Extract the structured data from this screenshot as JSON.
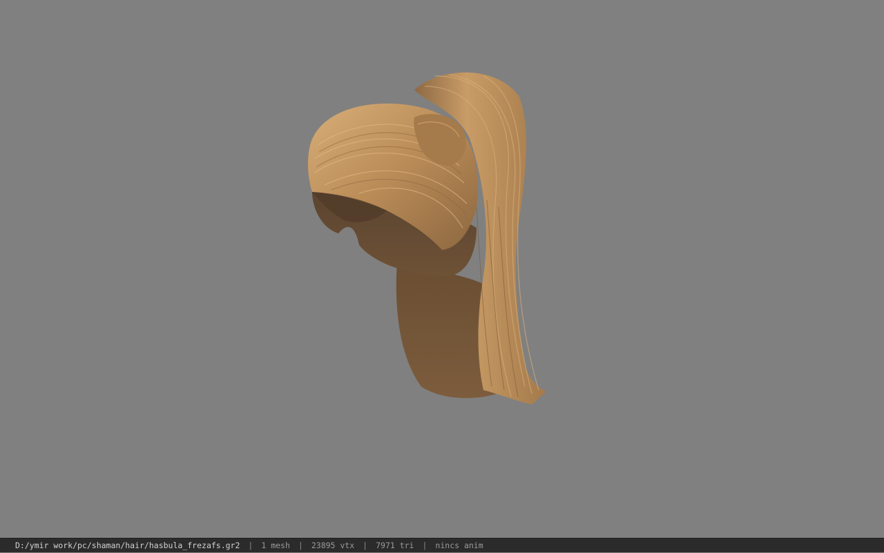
{
  "viewport": {
    "background": "#808080",
    "model_name": "hasbula_frezafs.gr2",
    "model_subject": "hair-model"
  },
  "status_bar": {
    "file_path": "D:/ymir work/pc/shaman/hair/hasbula_frezafs.gr2",
    "separator": "|",
    "mesh_count": "1 mesh",
    "vertex_count": "23895 vtx",
    "triangle_count": "7971 tri",
    "animation": "nincs anim"
  },
  "colors": {
    "hair_light": "#c89a63",
    "hair_mid": "#9a7448",
    "hair_dark": "#5e4630",
    "status_bg": "#2b2b2b",
    "status_text": "#9a9a9a"
  }
}
